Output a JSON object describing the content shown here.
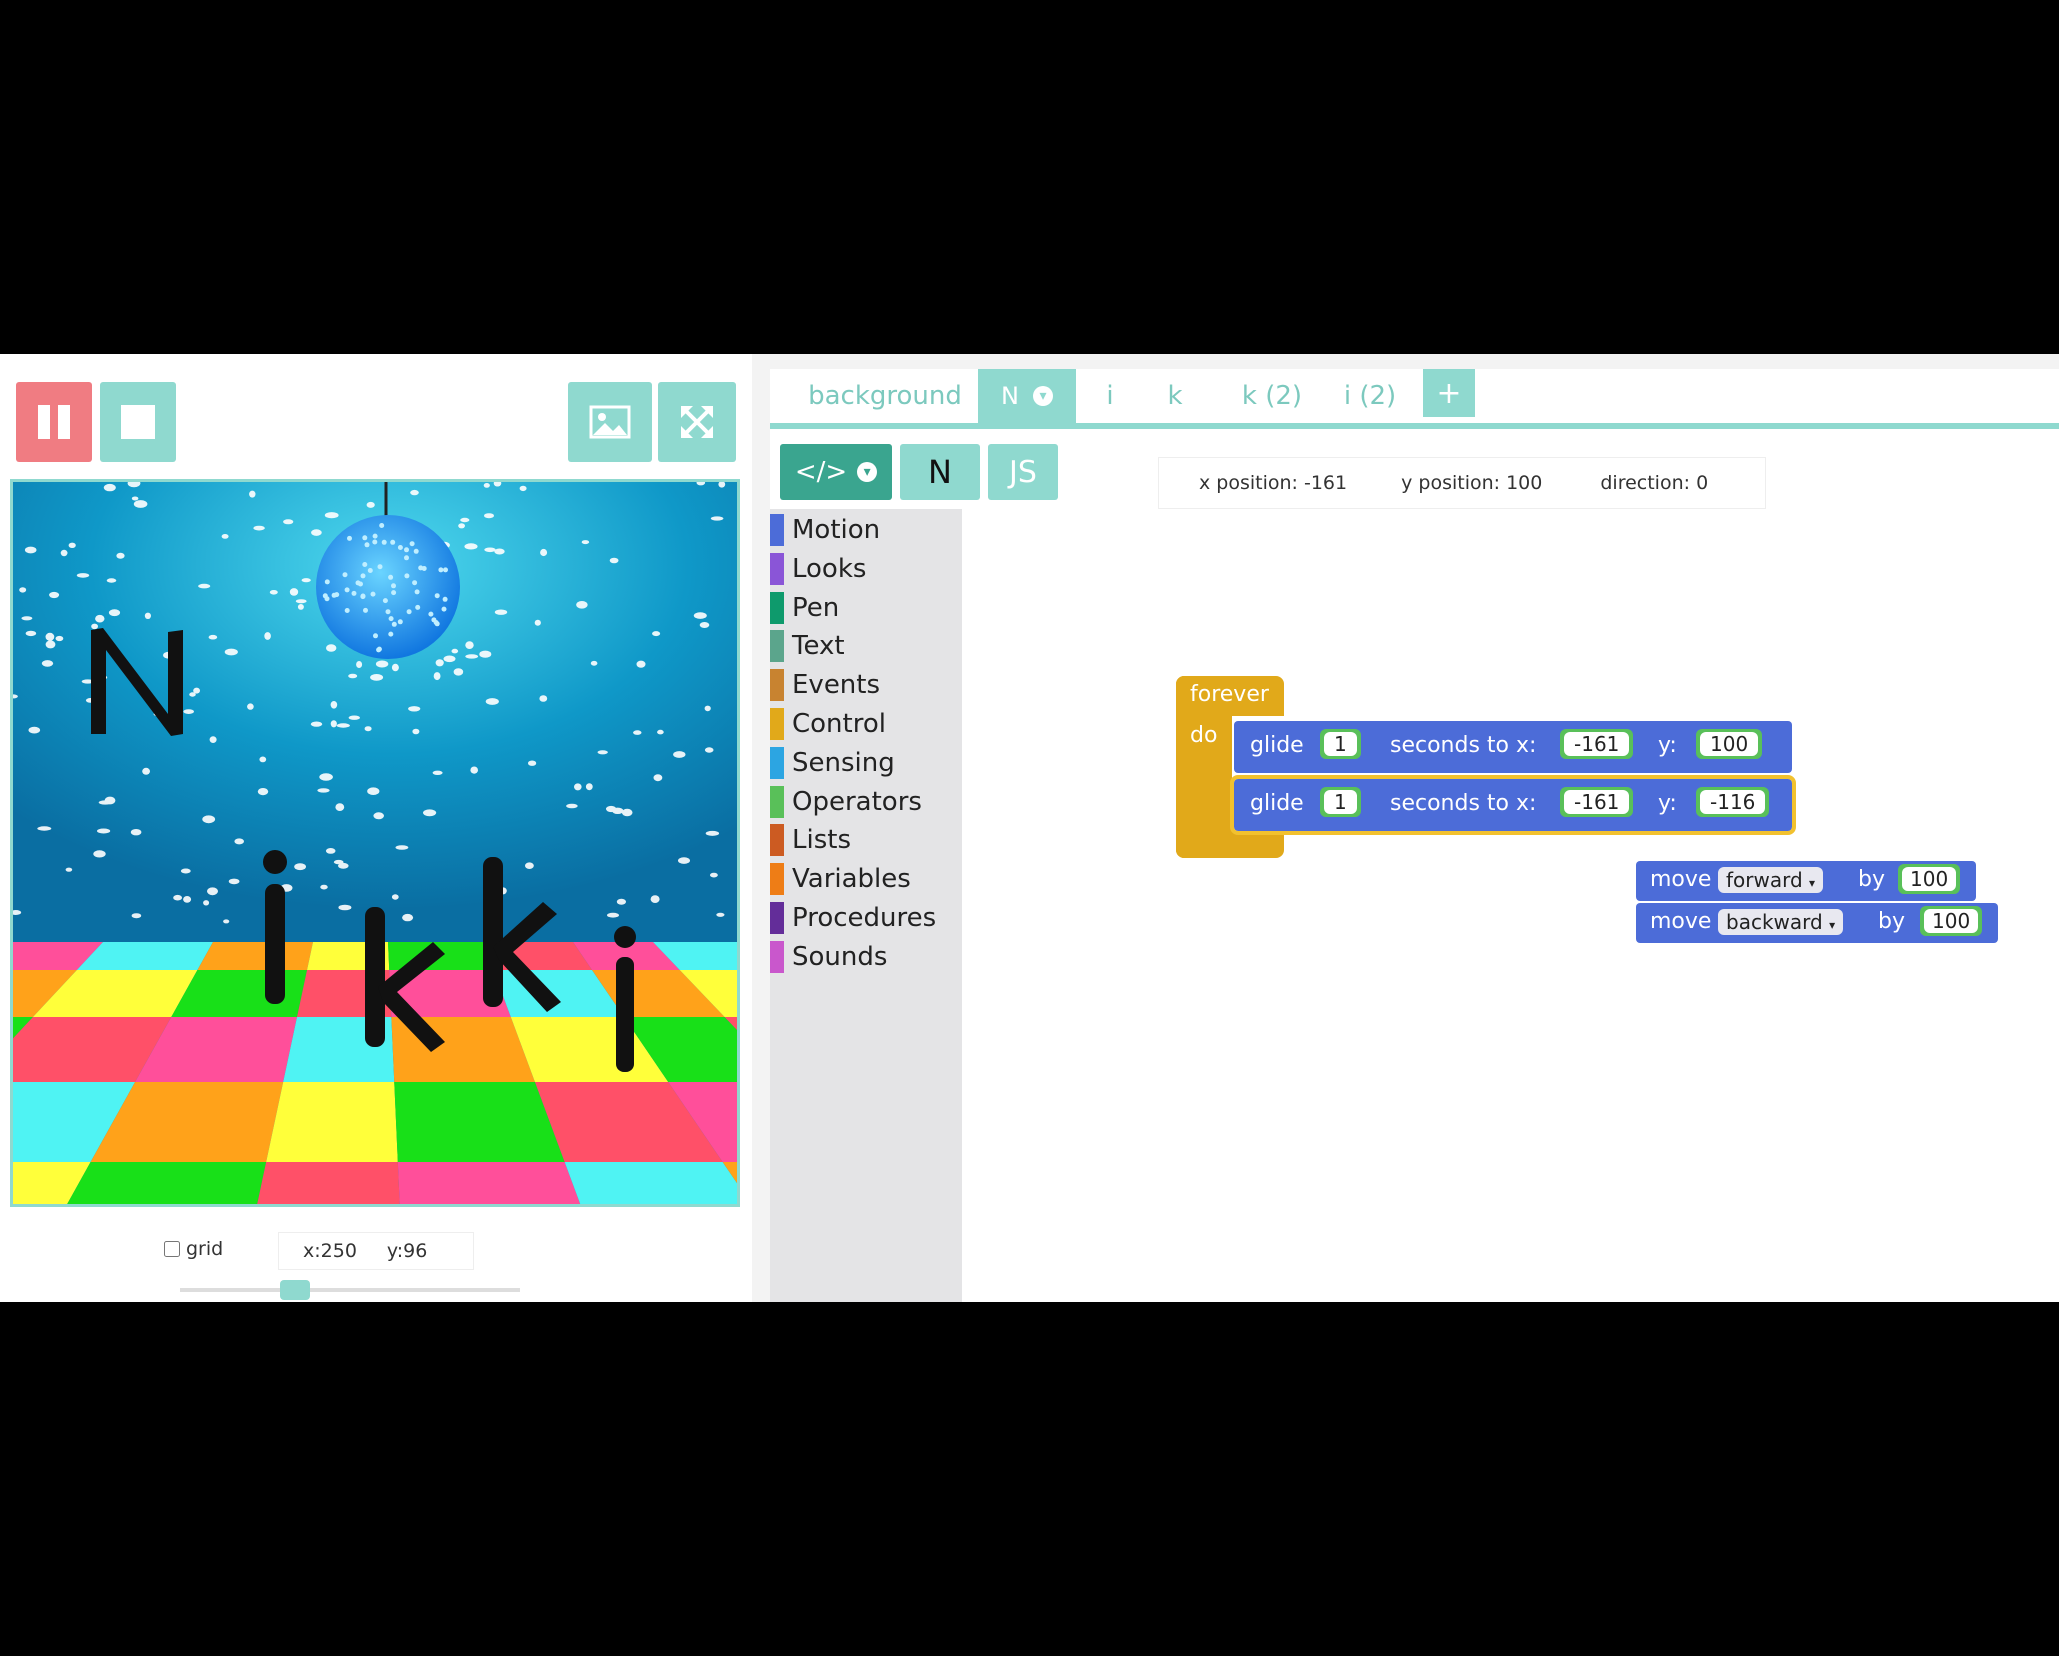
{
  "stage_toolbar": {
    "pause_icon": "pause-icon",
    "stop_icon": "stop-icon",
    "background_icon": "image-icon",
    "fullscreen_icon": "fullscreen-icon"
  },
  "stage": {
    "letters": [
      "N",
      "i",
      "k",
      "k",
      "i"
    ]
  },
  "stage_footer": {
    "grid_label": "grid",
    "x_readout": "x:250",
    "y_readout": "y:96"
  },
  "sprite_tabs": [
    {
      "label": "background"
    },
    {
      "label": "N"
    },
    {
      "label": "i"
    },
    {
      "label": "k"
    },
    {
      "label": "k (2)"
    },
    {
      "label": "i (2)"
    }
  ],
  "add_tab_label": "+",
  "editor_toolbar": {
    "code_label": "</>",
    "sprite_label": "N",
    "js_label": "JS"
  },
  "sprite_info": {
    "x_position": "x position: -161",
    "y_position": "y position: 100",
    "direction": "direction: 0"
  },
  "categories": [
    {
      "label": "Motion",
      "color": "#4c6cd8"
    },
    {
      "label": "Looks",
      "color": "#8a55d7"
    },
    {
      "label": "Pen",
      "color": "#0e9a6c"
    },
    {
      "label": "Text",
      "color": "#5ba58c"
    },
    {
      "label": "Events",
      "color": "#c88330"
    },
    {
      "label": "Control",
      "color": "#e1a91a"
    },
    {
      "label": "Sensing",
      "color": "#2ca5e2"
    },
    {
      "label": "Operators",
      "color": "#59c059"
    },
    {
      "label": "Lists",
      "color": "#cc5b22"
    },
    {
      "label": "Variables",
      "color": "#ee7d16"
    },
    {
      "label": "Procedures",
      "color": "#632d99"
    },
    {
      "label": "Sounds",
      "color": "#c957cc"
    }
  ],
  "blocks": {
    "forever_label": "forever",
    "do_label": "do",
    "glide1": {
      "verb": "glide",
      "secs": "1",
      "mid": "seconds to x:",
      "x": "-161",
      "ylabel": "y:",
      "y": "100"
    },
    "glide2": {
      "verb": "glide",
      "secs": "1",
      "mid": "seconds to x:",
      "x": "-161",
      "ylabel": "y:",
      "y": "-116"
    },
    "move1": {
      "verb": "move",
      "dir": "forward",
      "by": "by",
      "amount": "100"
    },
    "move2": {
      "verb": "move",
      "dir": "backward",
      "by": "by",
      "amount": "100"
    }
  }
}
